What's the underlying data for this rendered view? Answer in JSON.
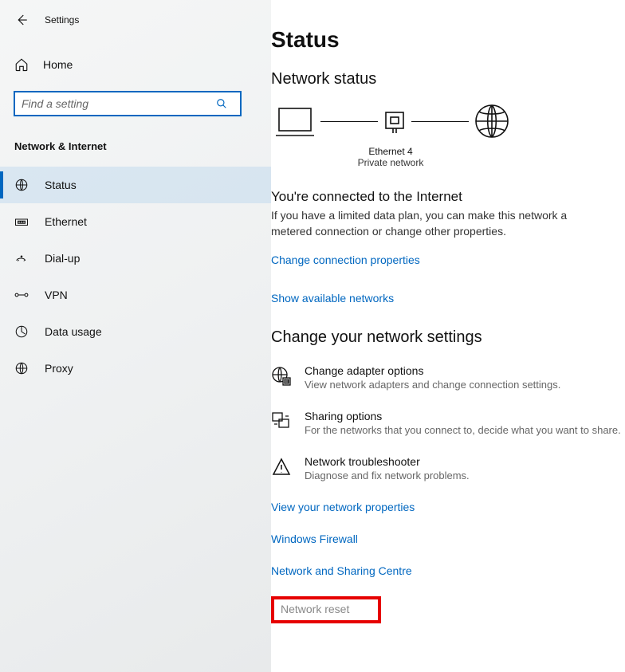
{
  "header": {
    "title": "Settings"
  },
  "home": {
    "label": "Home"
  },
  "search": {
    "placeholder": "Find a setting"
  },
  "section": {
    "label": "Network & Internet"
  },
  "nav": {
    "items": [
      {
        "label": "Status"
      },
      {
        "label": "Ethernet"
      },
      {
        "label": "Dial-up"
      },
      {
        "label": "VPN"
      },
      {
        "label": "Data usage"
      },
      {
        "label": "Proxy"
      }
    ]
  },
  "main": {
    "title": "Status",
    "network_status_heading": "Network status",
    "diagram": {
      "adapter_name": "Ethernet 4",
      "network_type": "Private network"
    },
    "connected": {
      "heading": "You're connected to the Internet",
      "desc": "If you have a limited data plan, you can make this network a metered connection or change other properties."
    },
    "link_change_props": "Change connection properties",
    "link_show_networks": "Show available networks",
    "change_settings_heading": "Change your network settings",
    "settings": [
      {
        "title": "Change adapter options",
        "desc": "View network adapters and change connection settings."
      },
      {
        "title": "Sharing options",
        "desc": "For the networks that you connect to, decide what you want to share."
      },
      {
        "title": "Network troubleshooter",
        "desc": "Diagnose and fix network problems."
      }
    ],
    "link_view_props": "View your network properties",
    "link_firewall": "Windows Firewall",
    "link_sharing_centre": "Network and Sharing Centre",
    "link_network_reset": "Network reset"
  }
}
